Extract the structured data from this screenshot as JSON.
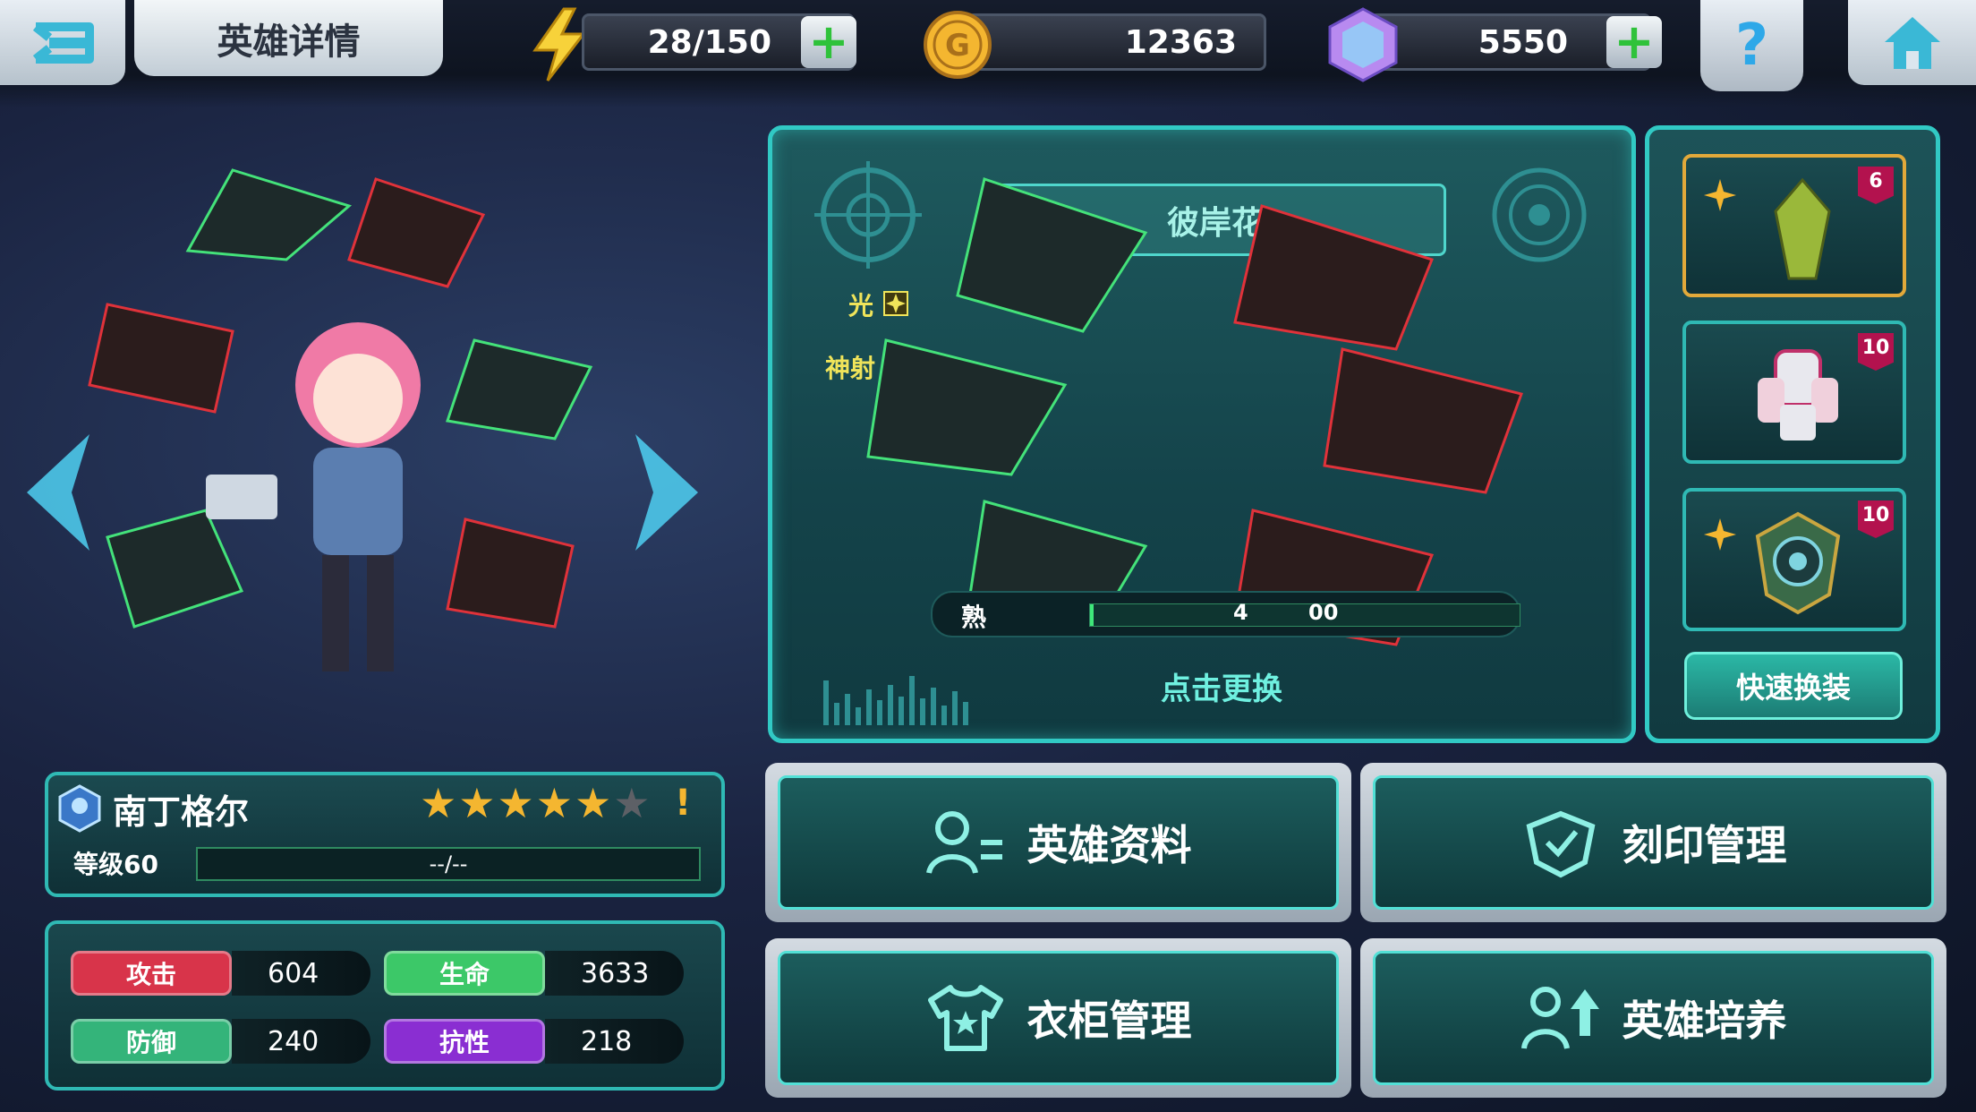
{
  "header": {
    "title": "英雄详情",
    "energy": "28/150",
    "gold": "12363",
    "gems": "5550",
    "help_icon": "?"
  },
  "detail": {
    "name_label": "彼岸花",
    "element_label": "光",
    "skill_label": "神射",
    "proficiency_label_partial": "熟",
    "proficiency_value_partial": "4",
    "proficiency_value_tail": "00",
    "change_label": "点击更换"
  },
  "equipment": {
    "slots": [
      {
        "level": "6",
        "border": "#e2a93a"
      },
      {
        "level": "10",
        "border": "#2fb9b4"
      },
      {
        "level": "10",
        "border": "#2fb9b4"
      }
    ],
    "quick_label": "快速换装"
  },
  "hero": {
    "name": "南丁格尔",
    "stars_filled": 5,
    "stars_total": 6,
    "alert": "!",
    "level_label": "等级60",
    "exp_text": "--/--"
  },
  "stats": {
    "atk_label": "攻击",
    "atk": "604",
    "hp_label": "生命",
    "hp": "3633",
    "def_label": "防御",
    "def": "240",
    "res_label": "抗性",
    "res": "218"
  },
  "menu": {
    "profile": "英雄资料",
    "imprint": "刻印管理",
    "wardrobe": "衣柜管理",
    "train": "英雄培养"
  },
  "colors": {
    "accent": "#31c9c4",
    "atk": "#d8344a",
    "hp": "#3cc868",
    "def": "#34b47a",
    "res": "#8a2ed2",
    "star": "#f4b630"
  }
}
